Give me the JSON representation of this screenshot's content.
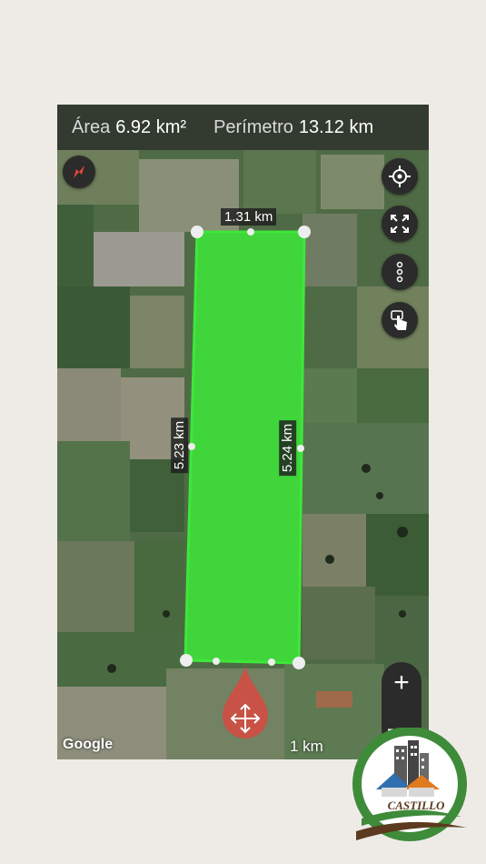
{
  "topbar": {
    "area_label": "Área",
    "area_value": "6.92 km²",
    "perimeter_label": "Perímetro",
    "perimeter_value": "13.12 km"
  },
  "polygon": {
    "top_edge": "1.31 km",
    "left_edge": "5.23 km",
    "right_edge": "5.24 km",
    "fill_color": "#3de83a"
  },
  "map": {
    "attribution": "Google",
    "scale_label": "1 km"
  },
  "controls": {
    "compass": "compass-icon",
    "locate": "crosshair-icon",
    "fullscreen": "expand-icon",
    "more": "more-vertical-icon",
    "touch": "touch-hand-icon",
    "zoom_in": "+",
    "zoom_out": "—",
    "move": "move-arrows-icon"
  },
  "logo": {
    "brand": "CASTILLO",
    "colors": {
      "green": "#3e8b3a",
      "brown": "#5b3a1f"
    }
  }
}
